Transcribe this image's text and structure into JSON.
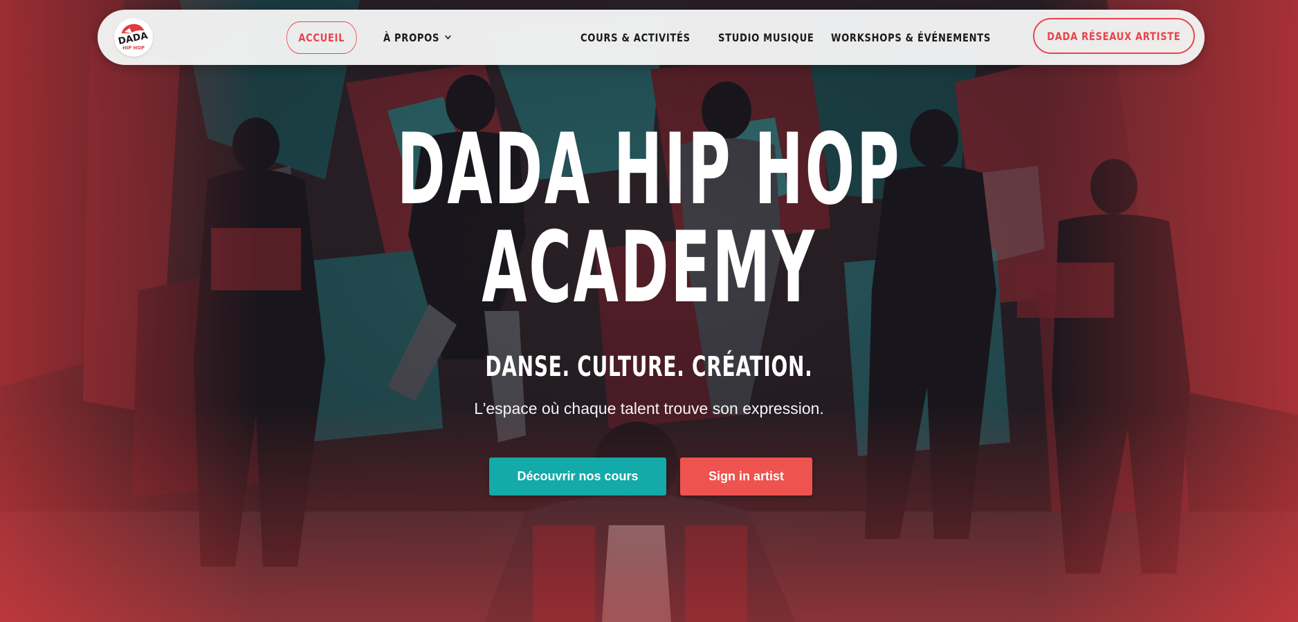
{
  "brand": {
    "logo_text": "DADA",
    "logo_subtext": "HIP HOP",
    "accent_color": "#e8454b",
    "teal_color": "#13aaa9"
  },
  "nav": {
    "items": [
      {
        "label": "ACCUEIL",
        "active": true
      },
      {
        "label": "À PROPOS",
        "has_dropdown": true,
        "icon": "chevron-down-icon"
      },
      {
        "label": "COURS & ACTIVITÉS"
      },
      {
        "label": "STUDIO MUSIQUE"
      },
      {
        "label": "WORKSHOPS & ÉVÉNEMENTS"
      }
    ],
    "cta_label": "DADA RÉSEAUX ARTISTE"
  },
  "hero": {
    "title_line1": "DADA HIP HOP",
    "title_line2": "ACADEMY",
    "tagline": "DANSE. CULTURE. CRÉATION.",
    "subtitle": "L'espace où chaque talent trouve son expression.",
    "primary_button": "Découvrir nos cours",
    "secondary_button": "Sign in artist"
  }
}
